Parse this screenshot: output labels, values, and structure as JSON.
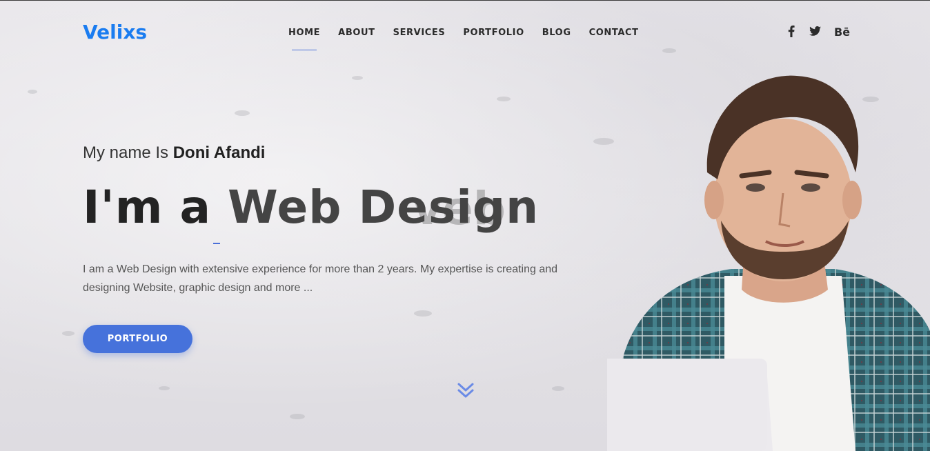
{
  "header": {
    "logo": "Velixs",
    "nav": [
      {
        "label": "HOME",
        "active": true
      },
      {
        "label": "ABOUT"
      },
      {
        "label": "SERVICES"
      },
      {
        "label": "PORTFOLIO"
      },
      {
        "label": "BLOG"
      },
      {
        "label": "CONTACT"
      }
    ],
    "social": [
      {
        "icon": "facebook-icon"
      },
      {
        "icon": "twitter-icon"
      },
      {
        "icon": "behance-icon",
        "label": "Bē"
      }
    ]
  },
  "hero": {
    "intro_prefix": "My name Is",
    "intro_name": "Doni Afandi",
    "headline_prefix": "I'm a",
    "headline_typed": "Web Design",
    "headline_ghost": "veb",
    "description": "I am a Web Design with extensive experience for more than 2 years. My expertise is creating and designing Website, graphic design and more ...",
    "cta_label": "PORTFOLIO",
    "scroll_icon": "double-chevron-down-icon"
  },
  "colors": {
    "brand": "#1a7cf0",
    "accent": "#4672db",
    "text": "#232323"
  }
}
